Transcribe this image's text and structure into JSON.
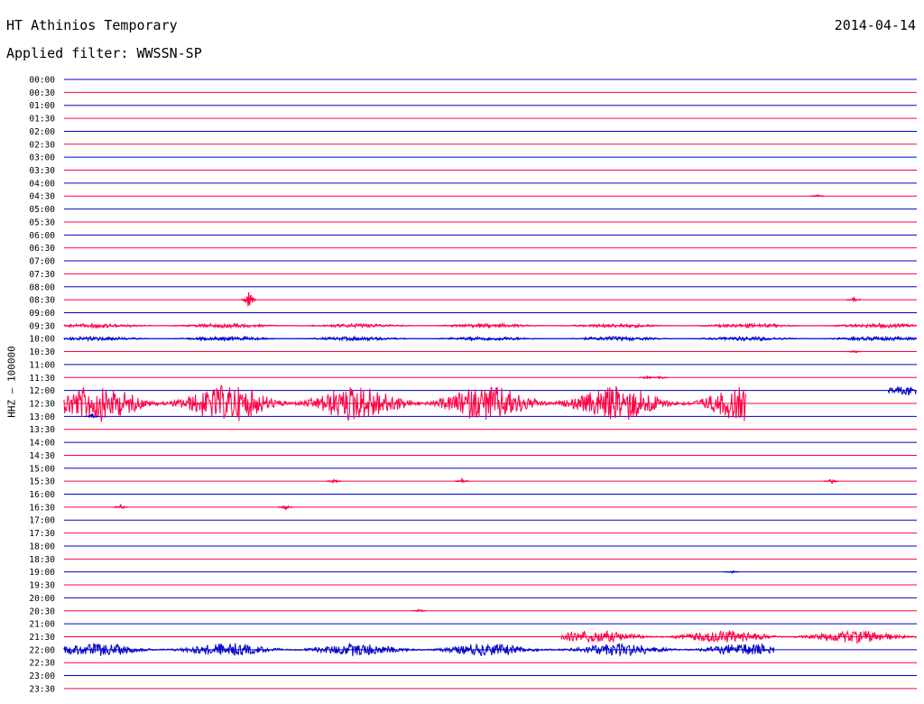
{
  "header": {
    "station": "HT Athinios Temporary",
    "date": "2014-04-14",
    "filter_label": "Applied filter: WWSSN-SP"
  },
  "chart_data": {
    "type": "seismogram-helicorder",
    "title": "HT Athinios Temporary",
    "date": "2014-04-14",
    "filter": "WWSSN-SP",
    "ylabel": "HHZ — 100000",
    "row_interval_minutes": 30,
    "rows": [
      "00:00",
      "00:30",
      "01:00",
      "01:30",
      "02:00",
      "02:30",
      "03:00",
      "03:30",
      "04:00",
      "04:30",
      "05:00",
      "05:30",
      "06:00",
      "06:30",
      "07:00",
      "07:30",
      "08:00",
      "08:30",
      "09:00",
      "09:30",
      "10:00",
      "10:30",
      "11:00",
      "11:30",
      "12:00",
      "12:30",
      "13:00",
      "13:30",
      "14:00",
      "14:30",
      "15:00",
      "15:30",
      "16:00",
      "16:30",
      "17:00",
      "17:30",
      "18:00",
      "18:30",
      "19:00",
      "19:30",
      "20:00",
      "20:30",
      "21:00",
      "21:30",
      "22:00",
      "22:30",
      "23:00",
      "23:30"
    ],
    "colors": {
      "even_rows": "#0000cc",
      "odd_rows": "#ff0044"
    },
    "x_range": [
      0,
      30
    ],
    "x_unit": "minutes",
    "high_activity_rows": [
      {
        "row": "12:30",
        "start": 0.0,
        "end": 24.0,
        "relative_amplitude": 1.0
      },
      {
        "row": "22:00",
        "start": 0.0,
        "end": 25.0,
        "relative_amplitude": 0.35
      },
      {
        "row": "21:30",
        "start": 17.5,
        "end": 30.0,
        "relative_amplitude": 0.35
      },
      {
        "row": "12:00",
        "start": 29.0,
        "end": 30.0,
        "relative_amplitude": 0.3
      },
      {
        "row": "09:30",
        "start": 0.0,
        "end": 30.0,
        "relative_amplitude": 0.12
      },
      {
        "row": "10:00",
        "start": 0.0,
        "end": 30.0,
        "relative_amplitude": 0.12
      }
    ],
    "events": [
      {
        "row": "08:30",
        "minute": 6.5,
        "relative_amplitude": 0.85
      },
      {
        "row": "11:30",
        "minute": 20.5,
        "relative_amplitude": 0.2
      },
      {
        "row": "11:30",
        "minute": 21.0,
        "relative_amplitude": 0.15
      },
      {
        "row": "04:30",
        "minute": 26.5,
        "relative_amplitude": 0.12
      },
      {
        "row": "15:30",
        "minute": 9.5,
        "relative_amplitude": 0.2
      },
      {
        "row": "15:30",
        "minute": 14.0,
        "relative_amplitude": 0.2
      },
      {
        "row": "15:30",
        "minute": 27.0,
        "relative_amplitude": 0.2
      },
      {
        "row": "16:30",
        "minute": 2.0,
        "relative_amplitude": 0.2
      },
      {
        "row": "16:30",
        "minute": 7.8,
        "relative_amplitude": 0.25
      },
      {
        "row": "13:00",
        "minute": 1.0,
        "relative_amplitude": 0.2
      },
      {
        "row": "08:30",
        "minute": 27.8,
        "relative_amplitude": 0.2
      },
      {
        "row": "10:30",
        "minute": 27.8,
        "relative_amplitude": 0.12
      },
      {
        "row": "20:30",
        "minute": 12.5,
        "relative_amplitude": 0.12
      },
      {
        "row": "19:00",
        "minute": 23.5,
        "relative_amplitude": 0.1
      }
    ]
  }
}
